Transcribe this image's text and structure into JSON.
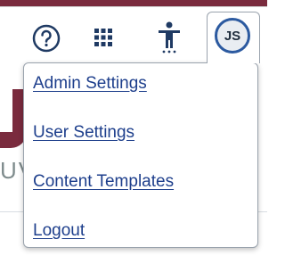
{
  "header": {
    "help_icon": "question-circle-icon",
    "apps_icon": "grid-apps-icon",
    "accessibility_icon": "accessibility-person-icon",
    "avatar_initials": "JS",
    "colors": {
      "brand_stripe": "#7a2b3e",
      "icon": "#1f3a63",
      "avatar_ring": "#2c5aa0"
    }
  },
  "background": {
    "logo_letters": "UV"
  },
  "user_menu": {
    "items": [
      {
        "label": "Admin Settings"
      },
      {
        "label": "User Settings"
      },
      {
        "label": "Content Templates"
      },
      {
        "label": "Logout"
      }
    ],
    "link_color": "#1e3f8c"
  }
}
